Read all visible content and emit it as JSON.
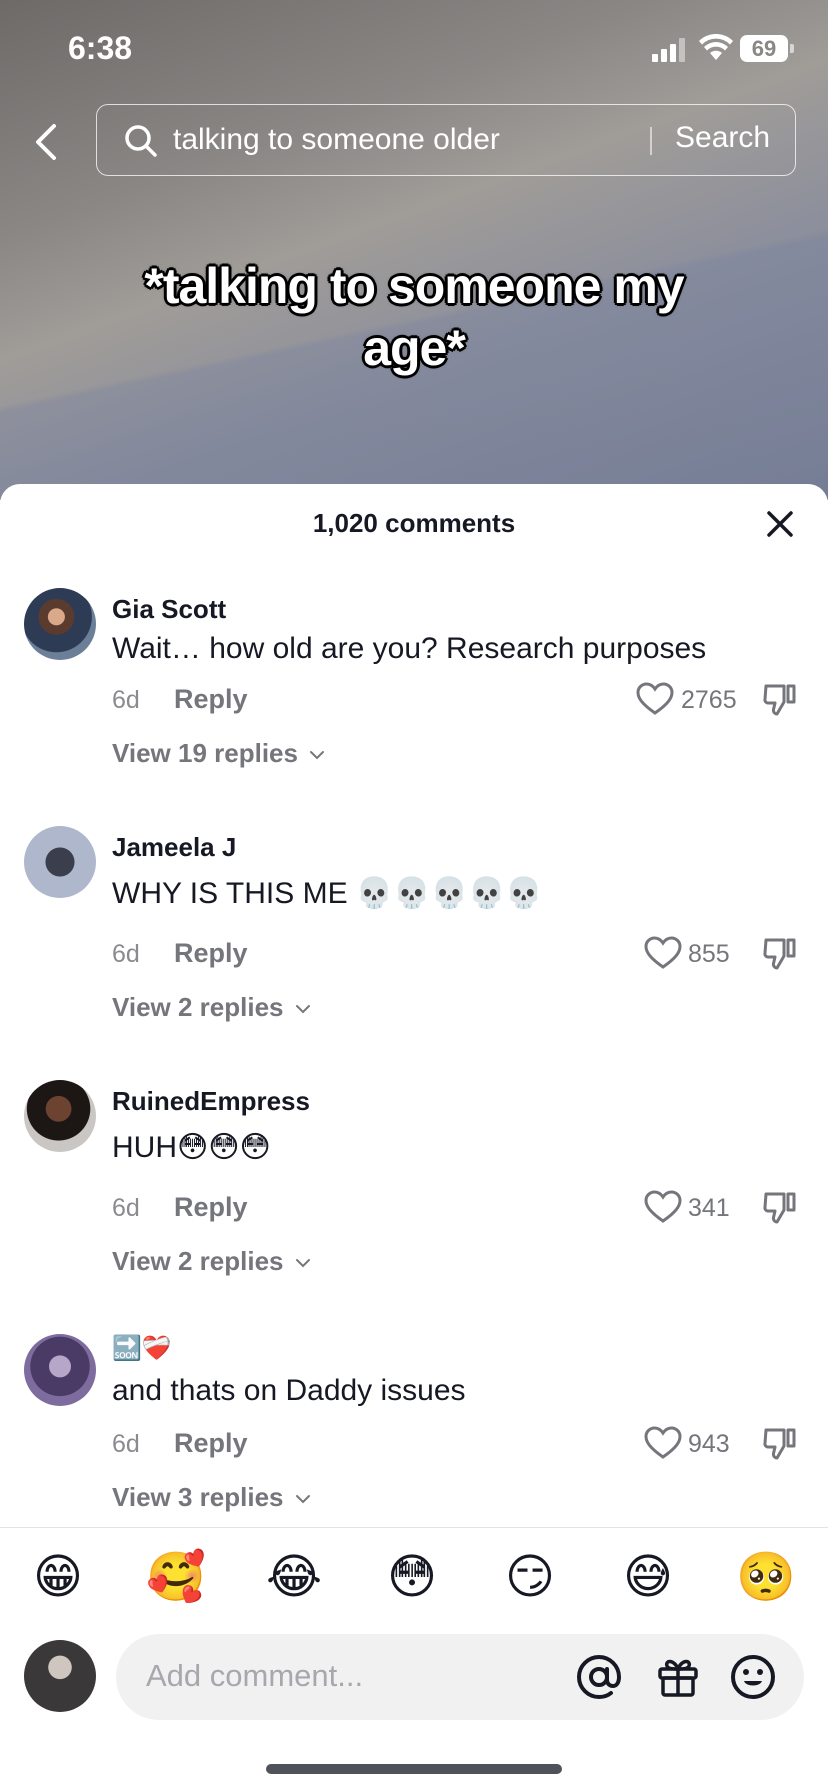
{
  "status_bar": {
    "time": "6:38",
    "battery": "69"
  },
  "search": {
    "query": "talking to someone older",
    "button_label": "Search"
  },
  "video": {
    "caption": "*talking to someone my age*"
  },
  "sheet": {
    "title": "1,020 comments"
  },
  "comments": [
    {
      "user": "Gia Scott",
      "text": "Wait… how old are you? Research purposes",
      "time": "6d",
      "reply_label": "Reply",
      "likes": "2765",
      "view_replies": "View 19 replies"
    },
    {
      "user": "Jameela J",
      "text": "WHY IS THIS ME 💀💀💀💀💀",
      "time": "6d",
      "reply_label": "Reply",
      "likes": "855",
      "view_replies": "View 2 replies"
    },
    {
      "user": "RuinedEmpress",
      "text": "HUH😳😳😳",
      "time": "6d",
      "reply_label": "Reply",
      "likes": "341",
      "view_replies": "View 2 replies"
    },
    {
      "user": "🔜❤️‍🩹",
      "text": "and thats on Daddy issues",
      "time": "6d",
      "reply_label": "Reply",
      "likes": "943",
      "view_replies": "View 3 replies"
    }
  ],
  "quick_emojis": [
    "😁",
    "🥰",
    "😂",
    "😳",
    "😏",
    "😅",
    "🥺"
  ],
  "input": {
    "placeholder": "Add comment..."
  },
  "icons": [
    "back-icon",
    "search-icon",
    "close-icon",
    "heart-icon",
    "dislike-icon",
    "chevron-down-icon",
    "mention-icon",
    "gift-icon",
    "emoji-icon"
  ],
  "colors": {
    "accent_text": "#161823",
    "muted_text": "#75767c",
    "input_bg": "#f1f1f2"
  }
}
